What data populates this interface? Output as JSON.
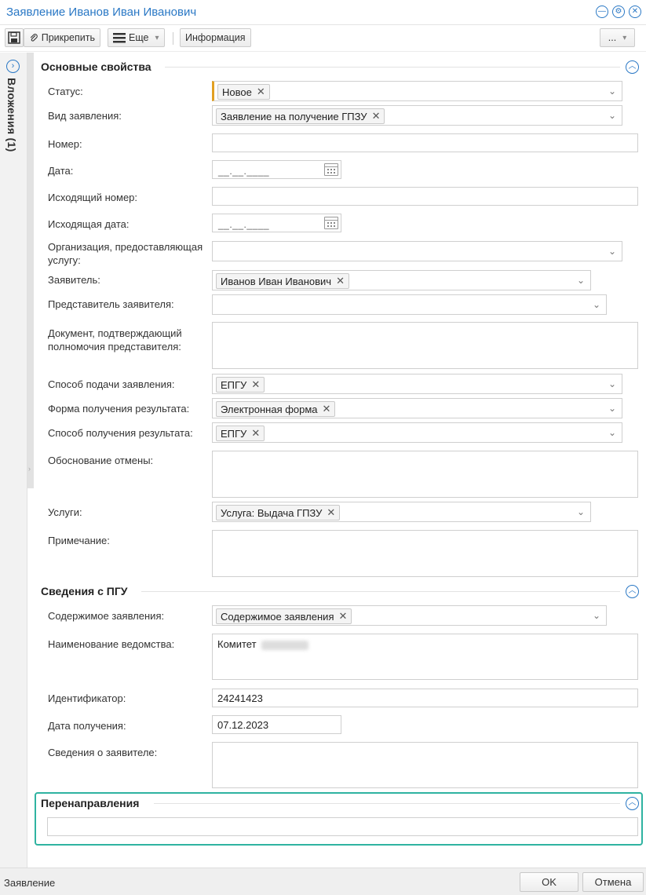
{
  "window": {
    "title": "Заявление Иванов Иван Иванович"
  },
  "toolbar": {
    "attach_label": "Прикрепить",
    "more_label": "Еще",
    "info_label": "Информация",
    "ellipsis_label": "..."
  },
  "sidebar": {
    "label": "Вложения (1)"
  },
  "sections": {
    "main": {
      "title": "Основные свойства"
    },
    "pgu": {
      "title": "Сведения с ПГУ"
    },
    "redirect": {
      "title": "Перенаправления"
    }
  },
  "fields": {
    "status": {
      "label": "Статус:",
      "chip": "Новое"
    },
    "type": {
      "label": "Вид заявления:",
      "chip": "Заявление на получение ГПЗУ"
    },
    "number": {
      "label": "Номер:",
      "value": ""
    },
    "date": {
      "label": "Дата:",
      "mask": "__.__.____"
    },
    "out_number": {
      "label": "Исходящий номер:",
      "value": ""
    },
    "out_date": {
      "label": "Исходящая дата:",
      "mask": "__.__.____"
    },
    "org": {
      "label": "Организация, предоставляющая услугу:"
    },
    "applicant": {
      "label": "Заявитель:",
      "chip": "Иванов Иван Иванович"
    },
    "representative": {
      "label": "Представитель заявителя:"
    },
    "doc": {
      "label": "Документ, подтверждающий полномочия представителя:"
    },
    "submit_method": {
      "label": "Способ подачи заявления:",
      "chip": "ЕПГУ"
    },
    "result_form": {
      "label": "Форма получения результата:",
      "chip": "Электронная форма"
    },
    "result_method": {
      "label": "Способ получения результата:",
      "chip": "ЕПГУ"
    },
    "cancel_reason": {
      "label": "Обоснование отмены:"
    },
    "services": {
      "label": "Услуги:",
      "chip": "Услуга: Выдача ГПЗУ"
    },
    "note": {
      "label": "Примечание:"
    },
    "content": {
      "label": "Содержимое заявления:",
      "chip": "Содержимое заявления"
    },
    "agency": {
      "label": "Наименование ведомства:",
      "value": "Комитет"
    },
    "identifier": {
      "label": "Идентификатор:",
      "value": "24241423"
    },
    "received_date": {
      "label": "Дата получения:",
      "value": "07.12.2023"
    },
    "applicant_info": {
      "label": "Сведения о заявителе:"
    }
  },
  "status_bar": {
    "text": "Заявление",
    "ok_label": "OK",
    "cancel_label": "Отмена"
  },
  "colors": {
    "accent": "#2a78c5",
    "highlight": "#2fb3a1",
    "required": "#e2a022"
  }
}
